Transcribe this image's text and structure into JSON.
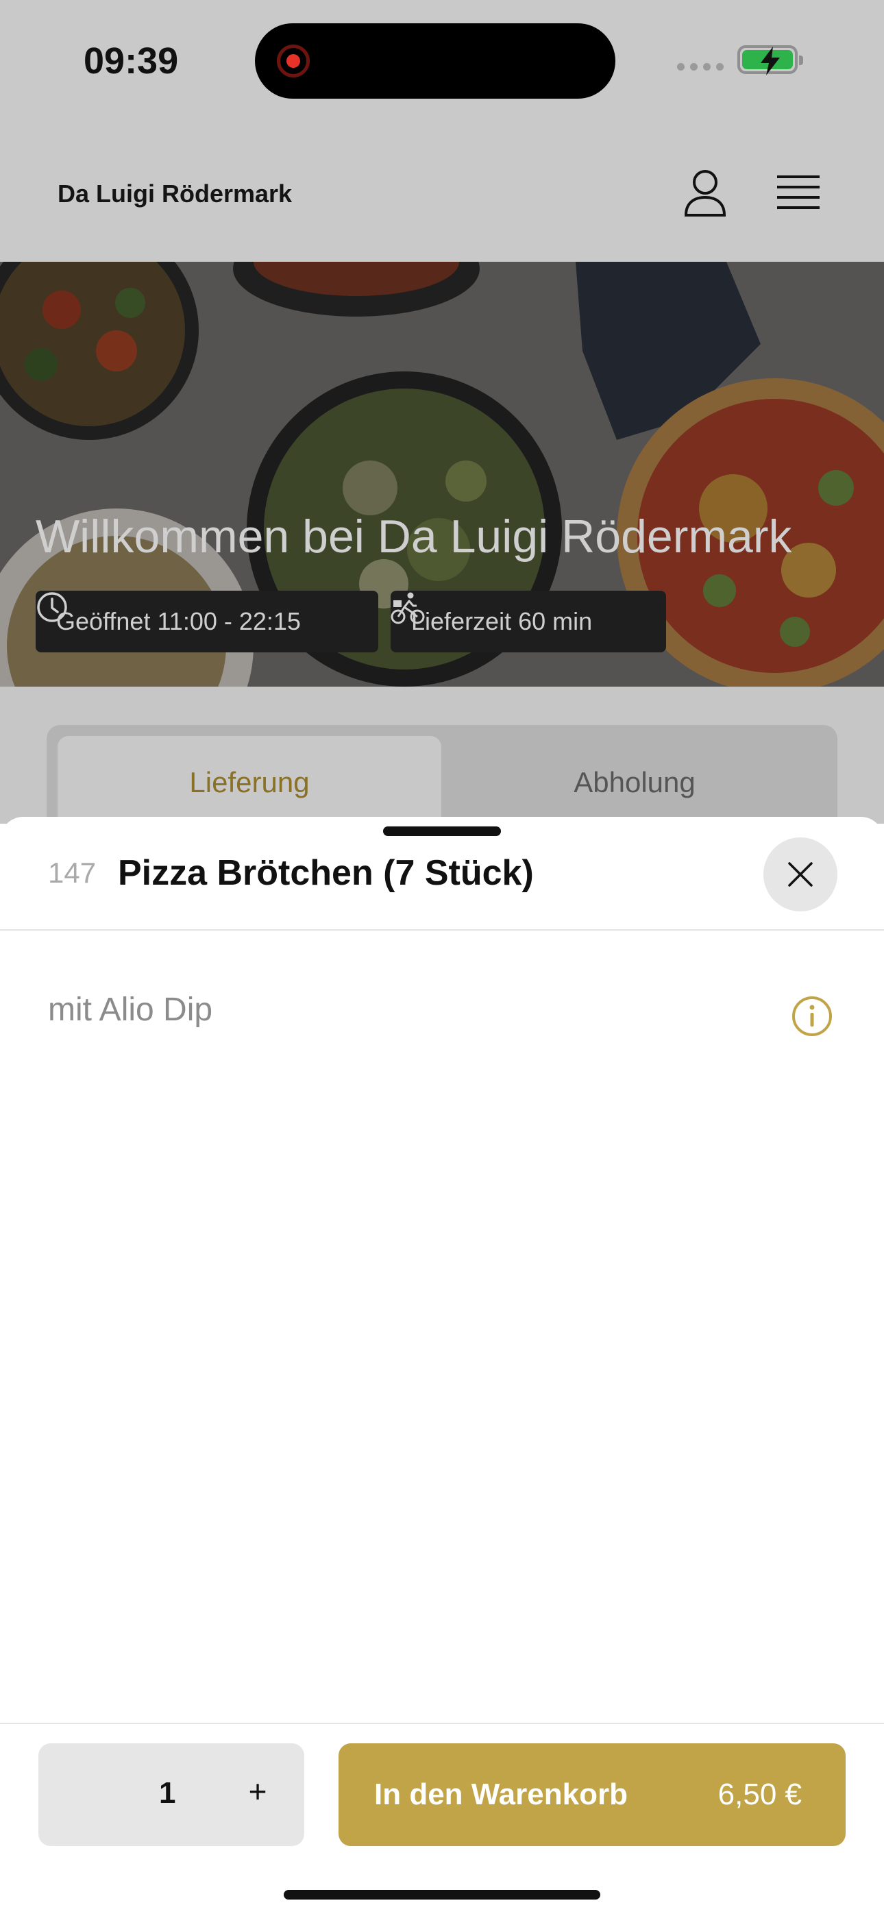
{
  "status_bar": {
    "time": "09:39"
  },
  "header": {
    "brand": "Da Luigi Rödermark",
    "icons": [
      "user-icon",
      "menu-icon"
    ]
  },
  "hero": {
    "title": "Willkommen bei Da Luigi Rödermark",
    "opening_hours": "Geöffnet 11:00 - 22:15",
    "delivery_time": "Lieferzeit 60 min"
  },
  "order_tabs": {
    "delivery": "Lieferung",
    "pickup": "Abholung",
    "selected": "delivery"
  },
  "sheet": {
    "item_number": "147",
    "item_name": "Pizza Brötchen (7 Stück)",
    "description": "mit Alio Dip",
    "quantity": "1",
    "plus_label": "+",
    "add_to_cart_label": "In den Warenkorb",
    "price": "6,50 €"
  },
  "colors": {
    "accent": "#c0a447",
    "accent_text": "#8a7125",
    "dim_overlay": "#c9c9c9"
  }
}
